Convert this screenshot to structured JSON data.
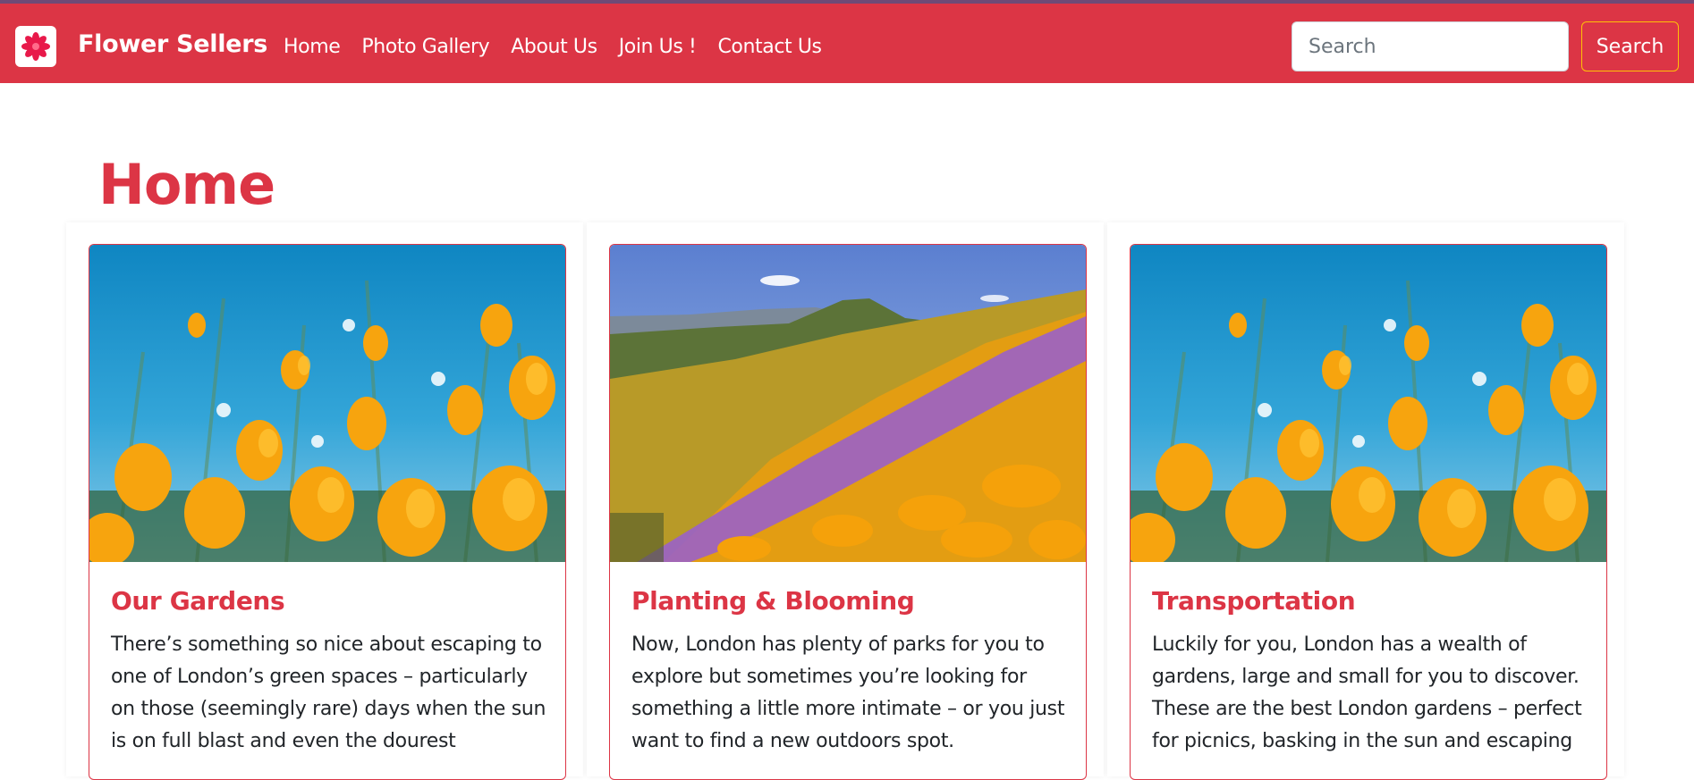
{
  "navbar": {
    "brand_name": "Flower Sellers",
    "logo_icon": "flower-logo-icon",
    "links": [
      "Home",
      "Photo Gallery",
      "About Us",
      "Join Us !",
      "Contact Us"
    ],
    "search_placeholder": "Search",
    "search_button_label": "Search",
    "colors": {
      "bar": "#dc3545",
      "search_border": "#ffc107"
    }
  },
  "main": {
    "title": "Home",
    "cards": [
      {
        "title": "Our Gardens",
        "text": "There’s something so nice about escaping to one of London’s green spaces – particularly on those (seemingly rare) days when the sun is on full blast and even the dourest",
        "image": "orange-poppies-blue-sky-photo"
      },
      {
        "title": "Planting & Blooming",
        "text": "Now, London has plenty of parks for you to explore but sometimes you’re looking for something a little more intimate – or you just want to find a new outdoors spot.",
        "image": "hillside-wildflowers-photo"
      },
      {
        "title": "Transportation",
        "text": "Luckily for you, London has a wealth of gardens, large and small for you to discover. These are the best London gardens – perfect for picnics, basking in the sun and escaping",
        "image": "orange-poppies-blue-sky-photo"
      }
    ]
  }
}
